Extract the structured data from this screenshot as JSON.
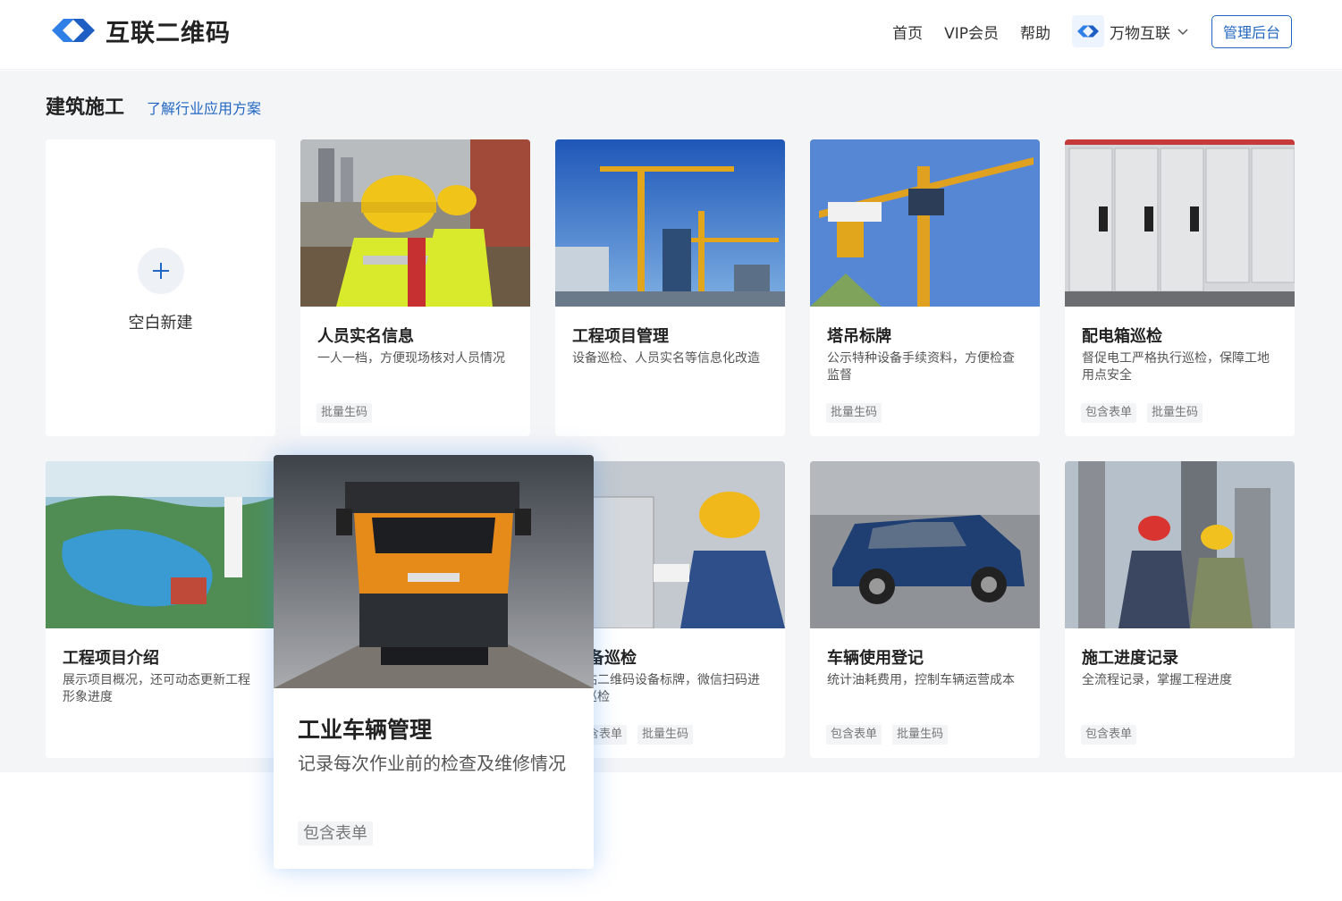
{
  "header": {
    "logo_text": "互联二维码",
    "nav": [
      {
        "label": "首页"
      },
      {
        "label": "VIP会员"
      },
      {
        "label": "帮助"
      }
    ],
    "brand_label": "万物互联",
    "admin_label": "管理后台"
  },
  "section": {
    "title": "建筑施工",
    "link": "了解行业应用方案"
  },
  "blank_card": {
    "label": "空白新建"
  },
  "cards": [
    {
      "title": "人员实名信息",
      "desc": "一人一档，方便现场核对人员情况",
      "tags": [
        "批量生码"
      ]
    },
    {
      "title": "工程项目管理",
      "desc": "设备巡检、人员实名等信息化改造",
      "tags": []
    },
    {
      "title": "塔吊标牌",
      "desc": "公示特种设备手续资料，方便检查监督",
      "tags": [
        "批量生码"
      ]
    },
    {
      "title": "配电箱巡检",
      "desc": "督促电工严格执行巡检，保障工地用点安全",
      "tags": [
        "包含表单",
        "批量生码"
      ]
    },
    {
      "title": "工程项目介绍",
      "desc": "展示项目概况，还可动态更新工程形象进度",
      "tags": []
    },
    {
      "title": "设备巡检",
      "desc": "张贴二维码设备标牌，微信扫码进行巡检",
      "tags": [
        "包含表单",
        "批量生码"
      ]
    },
    {
      "title": "车辆使用登记",
      "desc": "统计油耗费用，控制车辆运营成本",
      "tags": [
        "包含表单",
        "批量生码"
      ]
    },
    {
      "title": "施工进度记录",
      "desc": "全流程记录，掌握工程进度",
      "tags": [
        "包含表单"
      ]
    }
  ],
  "hover_card": {
    "title": "工业车辆管理",
    "desc": "记录每次作业前的检查及维修情况",
    "tags": [
      "包含表单"
    ]
  },
  "colors": {
    "accent": "#2166c2",
    "page_bg": "#f4f5f7"
  }
}
